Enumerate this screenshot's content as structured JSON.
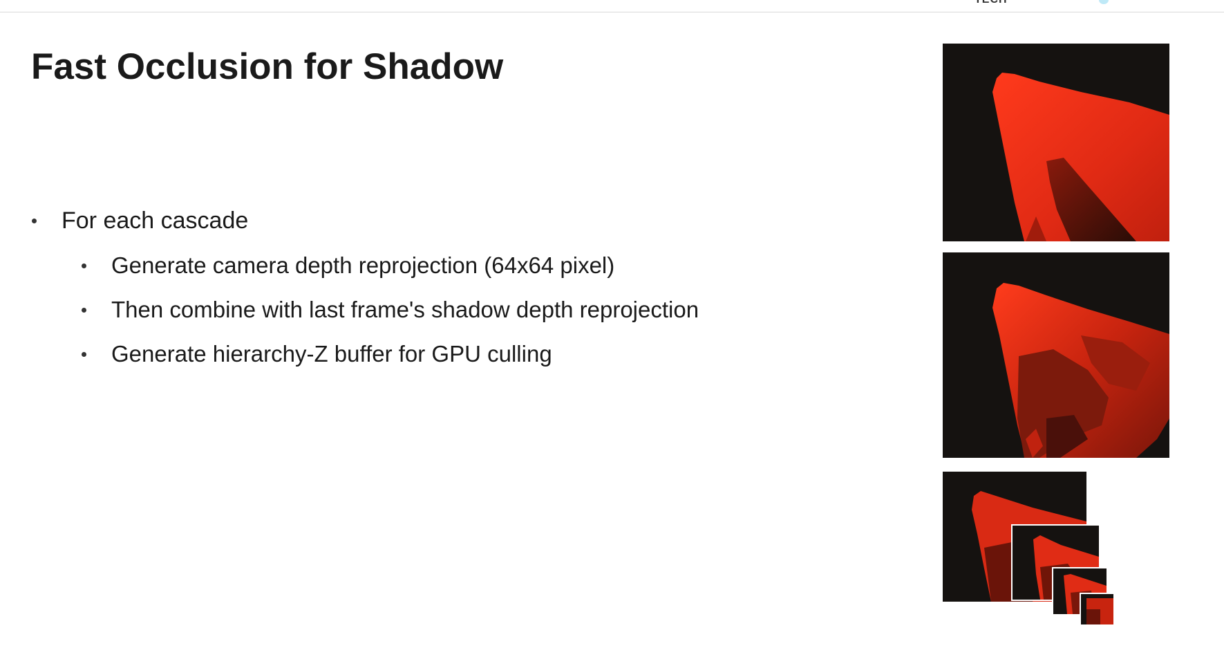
{
  "header": {
    "logo_text": "TECH"
  },
  "slide": {
    "title": "Fast Occlusion for Shadow",
    "bullets": [
      {
        "text": "For each cascade",
        "level": 1
      },
      {
        "text": "Generate camera depth reprojection (64x64 pixel)",
        "level": 2
      },
      {
        "text": "Then combine with last frame's shadow depth reprojection",
        "level": 2
      },
      {
        "text": "Generate hierarchy-Z buffer for GPU culling",
        "level": 2
      }
    ]
  },
  "colors": {
    "background": "#ffffff",
    "title_text": "#1a1a1a",
    "depth_red": "#e8301a",
    "depth_black": "#151210",
    "logo_accent": "#bfe9f7"
  }
}
